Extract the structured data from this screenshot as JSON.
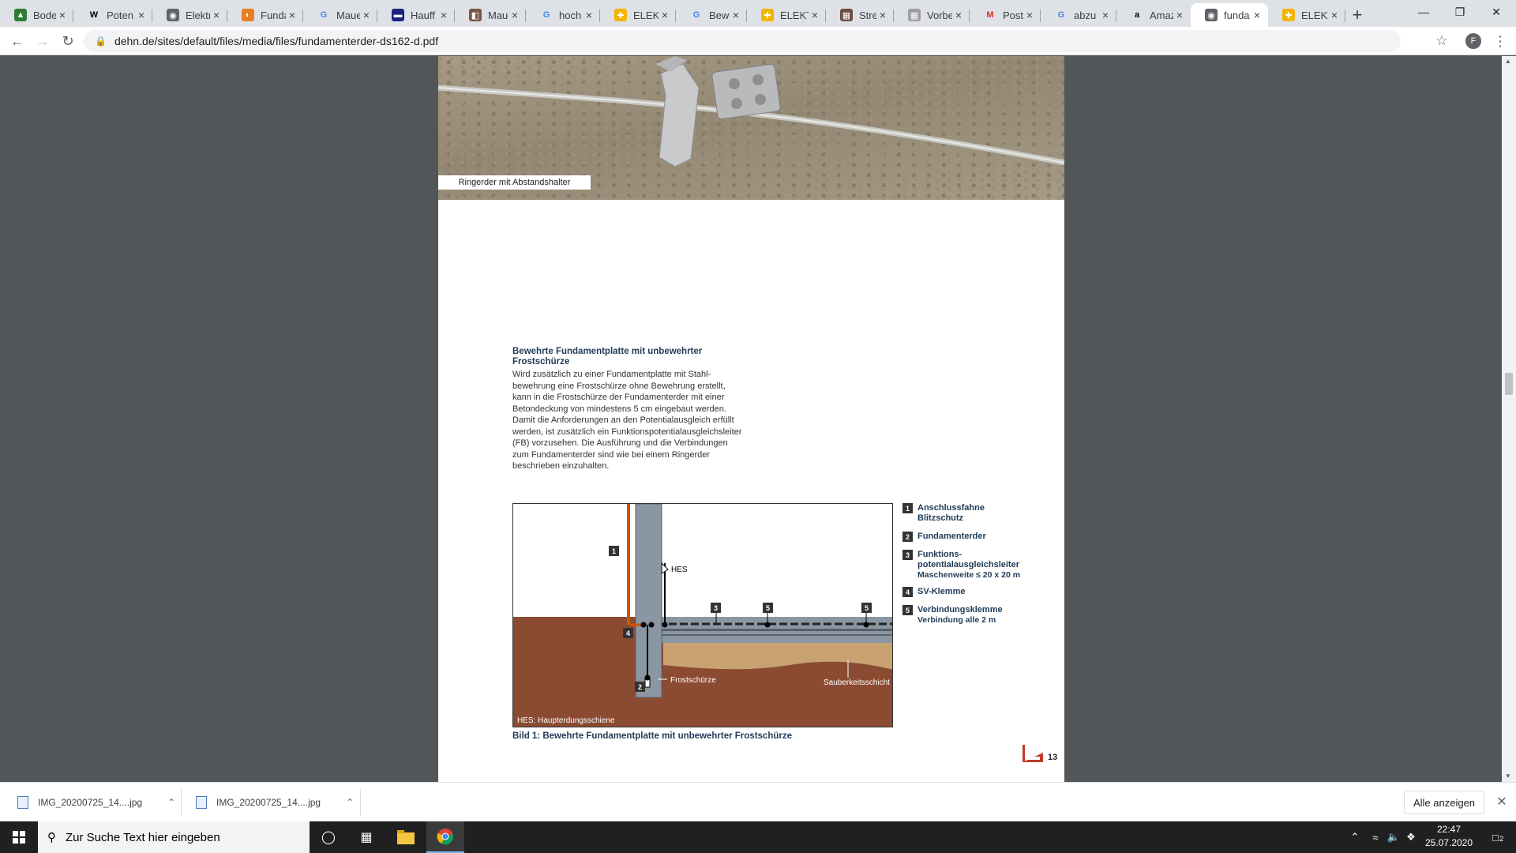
{
  "browser": {
    "tabs": [
      {
        "title": "Bode",
        "icon": "chart-icon",
        "color": "#2e7d32"
      },
      {
        "title": "Poten",
        "icon": "wikipedia-icon",
        "color": "#000000"
      },
      {
        "title": "Elektr",
        "icon": "globe-icon",
        "color": "#5f6368"
      },
      {
        "title": "Funda",
        "icon": "orange-circle-icon",
        "color": "#e67e22"
      },
      {
        "title": "Maue",
        "icon": "google-icon",
        "color": "#4285f4"
      },
      {
        "title": "Hauff",
        "icon": "truck-icon",
        "color": "#1a237e"
      },
      {
        "title": "Maue",
        "icon": "tag-icon",
        "color": "#795548"
      },
      {
        "title": "hoch",
        "icon": "google-icon",
        "color": "#4285f4"
      },
      {
        "title": "ELEKT",
        "icon": "plus-circle-icon",
        "color": "#f4b400"
      },
      {
        "title": "Bewe",
        "icon": "google-icon",
        "color": "#4285f4"
      },
      {
        "title": "ELEKT",
        "icon": "plus-circle-icon",
        "color": "#f4b400"
      },
      {
        "title": "Streif",
        "icon": "image-icon",
        "color": "#6d4c41"
      },
      {
        "title": "Vorbe",
        "icon": "image-icon",
        "color": "#9e9e9e"
      },
      {
        "title": "Poste",
        "icon": "gmail-icon",
        "color": "#d93025"
      },
      {
        "title": "abzu",
        "icon": "google-icon",
        "color": "#4285f4"
      },
      {
        "title": "Amaz",
        "icon": "amazon-icon",
        "color": "#000000"
      },
      {
        "title": "funda",
        "icon": "globe-icon",
        "color": "#5f6368",
        "active": true
      },
      {
        "title": "ELEKT",
        "icon": "plus-circle-icon",
        "color": "#f4b400"
      }
    ],
    "new_tab": "+",
    "url": "dehn.de/sites/default/files/media/files/fundamenterder-ds162-d.pdf",
    "profile_initial": "F"
  },
  "document": {
    "photo_caption": "Ringerder mit Abstandshalter",
    "heading": [
      "Bewehrte Fundamentplatte mit unbewehrter",
      "Frostschürze"
    ],
    "body_lines": [
      "Wird zusätzlich zu einer Fundamentplatte mit Stahl-",
      "bewehrung eine Frostschürze ohne Bewehrung erstellt,",
      "kann in die Frostschürze der Fundamenterder mit einer",
      "Betondeckung von mindestens 5 cm eingebaut werden.",
      "Damit die Anforderungen an den Potentialausgleich erfüllt",
      "werden, ist zusätzlich ein Funktionspotentialausgleichsleiter",
      "(FB) vorzusehen. Die Ausführung und die Verbindungen",
      "zum Fundamenterder sind wie bei einem Ringerder",
      "beschrieben einzuhalten."
    ],
    "figure": {
      "labels": {
        "hes": "HES",
        "frostschuerze": "Frostschürze",
        "sauberkeitsschicht": "Sauberkeitsschicht",
        "hes_note": "HES: Haupterdungsschiene"
      },
      "markers": [
        "1",
        "2",
        "3",
        "4",
        "5",
        "5"
      ]
    },
    "legend": [
      {
        "num": "1",
        "text": "Anschlussfahne",
        "sub": "Blitzschutz"
      },
      {
        "num": "2",
        "text": "Fundamenterder",
        "sub": ""
      },
      {
        "num": "3",
        "text": "Funktions-",
        "sub": "potentialausgleichsleiter",
        "sub2": "Maschenweite ≤ 20 x 20 m"
      },
      {
        "num": "4",
        "text": "SV-Klemme",
        "sub": ""
      },
      {
        "num": "5",
        "text": "Verbindungsklemme",
        "sub": "Verbindung alle 2 m"
      }
    ],
    "figure_caption": "Bild 1: Bewehrte Fundamentplatte mit unbewehrter Frostschürze",
    "page_number": "13"
  },
  "downloads": {
    "items": [
      "IMG_20200725_14....jpg",
      "IMG_20200725_14....jpg"
    ],
    "show_all": "Alle anzeigen"
  },
  "taskbar": {
    "search_placeholder": "Zur Suche Text hier eingeben",
    "time": "22:47",
    "date": "25.07.2020",
    "notification_count": "2"
  },
  "colors": {
    "soil": "#8b4b32",
    "sand": "#c8a271",
    "concrete": "#8a97a3",
    "lightning_rod": "#d35400",
    "text_blue": "#1f3b57"
  }
}
